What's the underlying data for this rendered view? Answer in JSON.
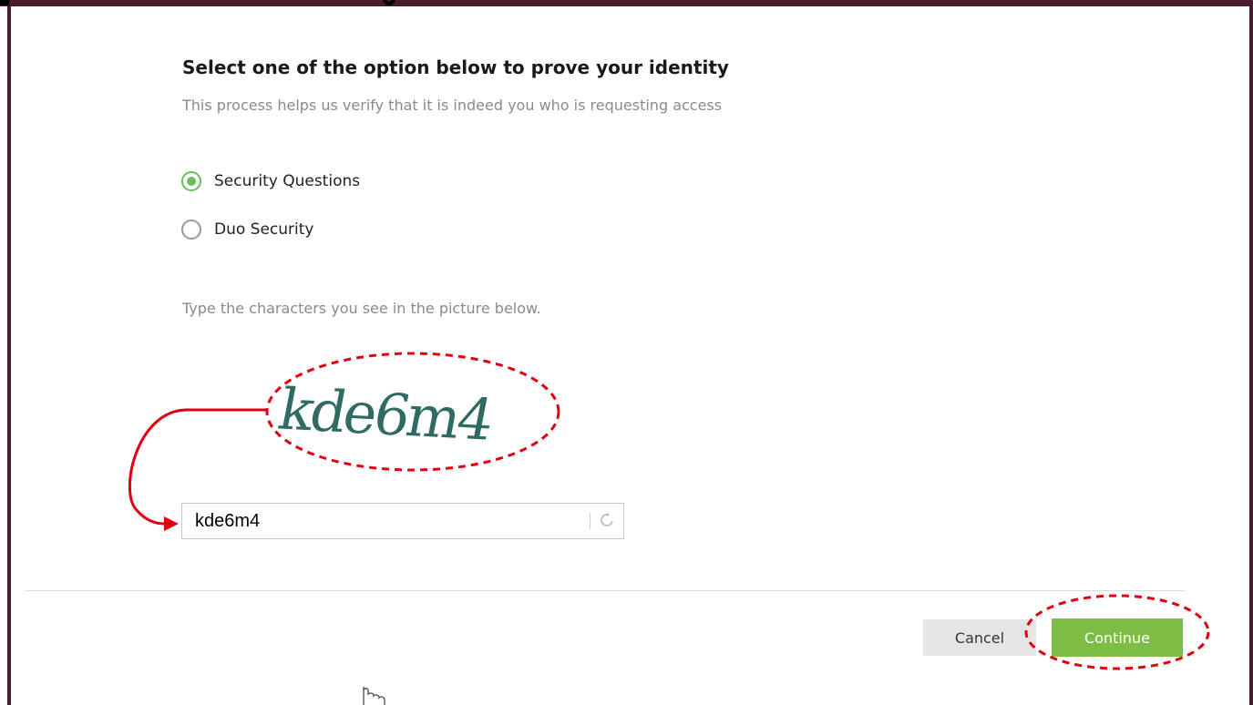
{
  "header": {
    "title": "Select one of the option below to prove your identity",
    "subtitle": "This process helps us verify that it is indeed you who is requesting access"
  },
  "verification_options": [
    {
      "label": "Security Questions",
      "selected": true
    },
    {
      "label": "Duo Security",
      "selected": false
    }
  ],
  "captcha": {
    "instruction": "Type the characters you see in the picture below.",
    "image_text": "kde6m4",
    "input_value": "kde6m4",
    "refresh_icon": "refresh-icon"
  },
  "actions": {
    "cancel_label": "Cancel",
    "continue_label": "Continue"
  },
  "colors": {
    "frame": "#4a1a2f",
    "accent_green": "#7cbd45",
    "radio_green": "#6bbf59",
    "annotation_red": "#e0000f",
    "captcha_text": "#2f6b63"
  }
}
